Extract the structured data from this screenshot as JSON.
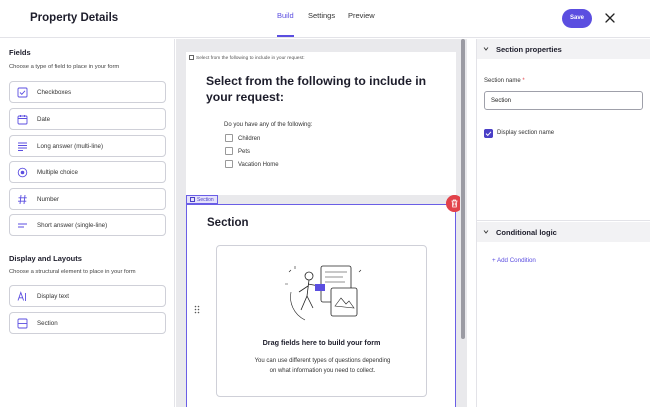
{
  "header": {
    "title": "Property Details",
    "tabs": [
      {
        "label": "Build",
        "active": true
      },
      {
        "label": "Settings",
        "active": false
      },
      {
        "label": "Preview",
        "active": false
      }
    ],
    "save_label": "Save",
    "accent_color": "#5b4ee0"
  },
  "left_panel": {
    "fields_heading": "Fields",
    "fields_sub": "Choose a type of field to place in your form",
    "fields": [
      {
        "label": "Checkboxes",
        "icon": "checkbox-icon"
      },
      {
        "label": "Date",
        "icon": "calendar-icon"
      },
      {
        "label": "Long answer (multi-line)",
        "icon": "multiline-text-icon"
      },
      {
        "label": "Multiple choice",
        "icon": "radio-choice-icon"
      },
      {
        "label": "Number",
        "icon": "hash-icon"
      },
      {
        "label": "Short answer (single-line)",
        "icon": "single-line-text-icon"
      }
    ],
    "layouts_heading": "Display and Layouts",
    "layouts_sub": "Choose a structural element to place in your form",
    "layouts": [
      {
        "label": "Display text",
        "icon": "text-format-icon"
      },
      {
        "label": "Section",
        "icon": "section-icon"
      }
    ]
  },
  "canvas": {
    "crumb": "Select from the following to include in your request:",
    "page_title": "Select from the following to include in your request:",
    "question": "Do you have any of the following:",
    "options": [
      "Children",
      "Pets",
      "Vacation Home"
    ],
    "section_tag": "Section",
    "section_title": "Section",
    "drop_title": "Drag fields here to build your form",
    "drop_text": "You can use different types of questions depending on what information you need to collect."
  },
  "right_panel": {
    "section_props_heading": "Section properties",
    "section_name_label": "Section name",
    "required_mark": "*",
    "section_name_value": "Section",
    "display_name_label": "Display section name",
    "display_name_checked": true,
    "conditional_heading": "Conditional logic",
    "add_condition_label": "+ Add Condition"
  }
}
